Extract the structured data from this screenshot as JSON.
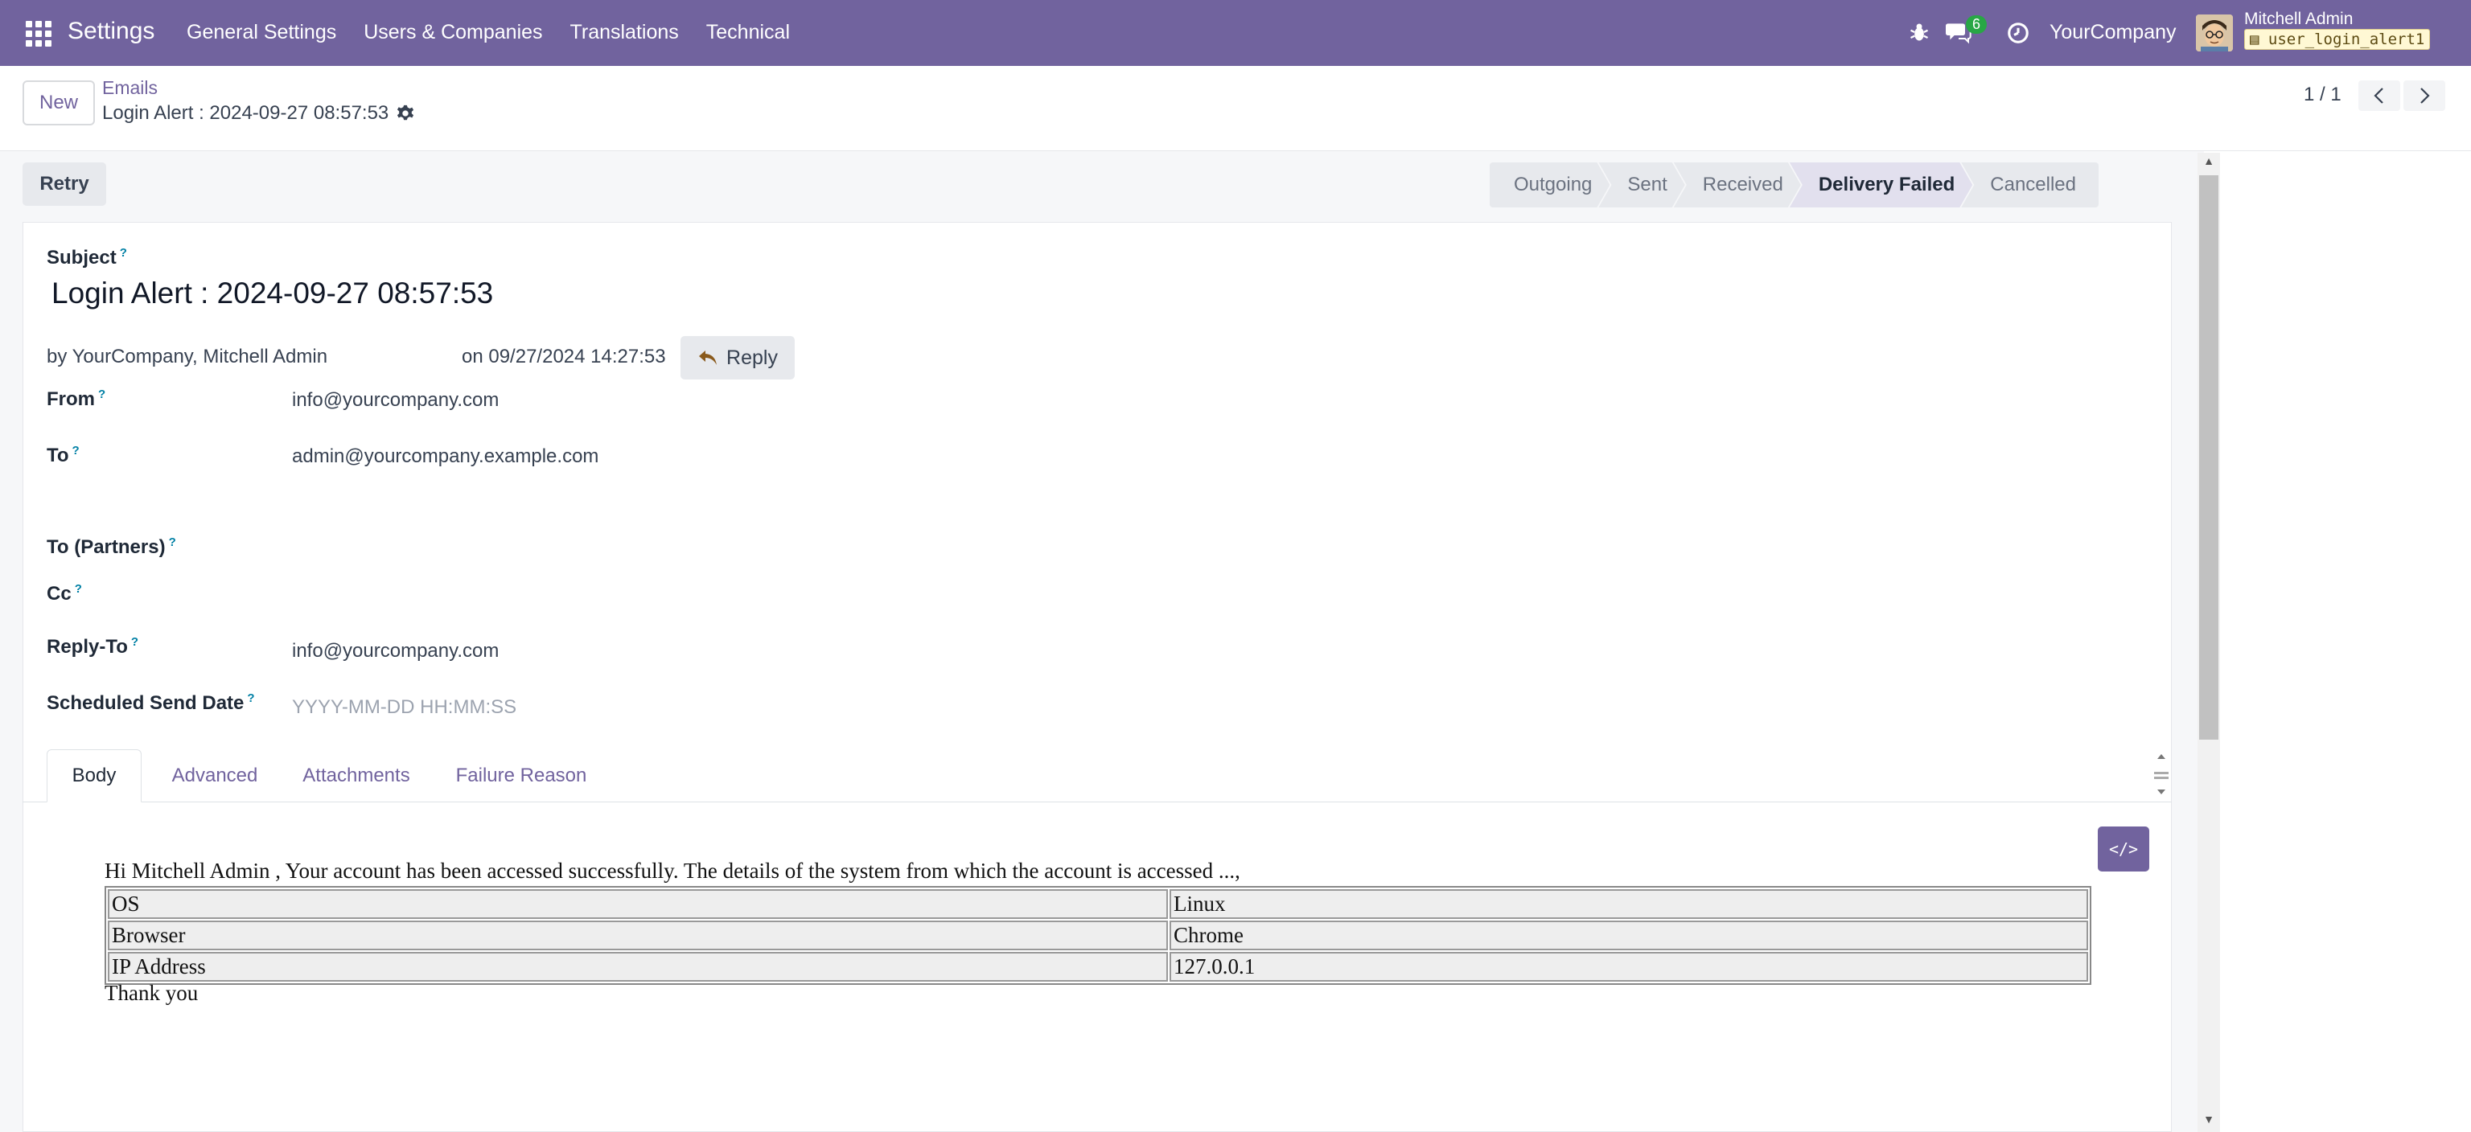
{
  "navbar": {
    "app_title": "Settings",
    "menu": [
      "General Settings",
      "Users & Companies",
      "Translations",
      "Technical"
    ],
    "chat_count": "6",
    "company": "YourCompany",
    "user_name": "Mitchell Admin",
    "database": "user_login_alert1"
  },
  "control": {
    "new_label": "New",
    "breadcrumb_parent": "Emails",
    "breadcrumb_current": "Login Alert : 2024-09-27 08:57:53",
    "pager": "1 / 1"
  },
  "actions": {
    "retry_label": "Retry"
  },
  "statusbar": {
    "stages": [
      "Outgoing",
      "Sent",
      "Received",
      "Delivery Failed",
      "Cancelled"
    ],
    "active": "Delivery Failed"
  },
  "form": {
    "subject_label": "Subject",
    "subject_value": "Login Alert : 2024-09-27 08:57:53",
    "by_text": "by  YourCompany, Mitchell Admin",
    "date_text": "on 09/27/2024 14:27:53",
    "reply_label": "Reply",
    "from_label": "From",
    "from_value": "info@yourcompany.com",
    "to_label": "To",
    "to_value": "admin@yourcompany.example.com",
    "to_partners_label": "To (Partners)",
    "cc_label": "Cc",
    "reply_to_label": "Reply-To",
    "reply_to_value": "info@yourcompany.com",
    "scheduled_label": "Scheduled Send Date",
    "scheduled_placeholder": "YYYY-MM-DD HH:MM:SS",
    "help_marker": "?"
  },
  "tabs": [
    "Body",
    "Advanced",
    "Attachments",
    "Failure Reason"
  ],
  "body": {
    "code_button": "</>",
    "intro": "Hi Mitchell Admin , Your account has been accessed successfully. The details of the system from which the account is accessed ...,",
    "rows": [
      [
        "OS",
        "Linux"
      ],
      [
        "Browser",
        "Chrome"
      ],
      [
        "IP Address",
        "127.0.0.1"
      ]
    ],
    "outro": "Thank you"
  }
}
